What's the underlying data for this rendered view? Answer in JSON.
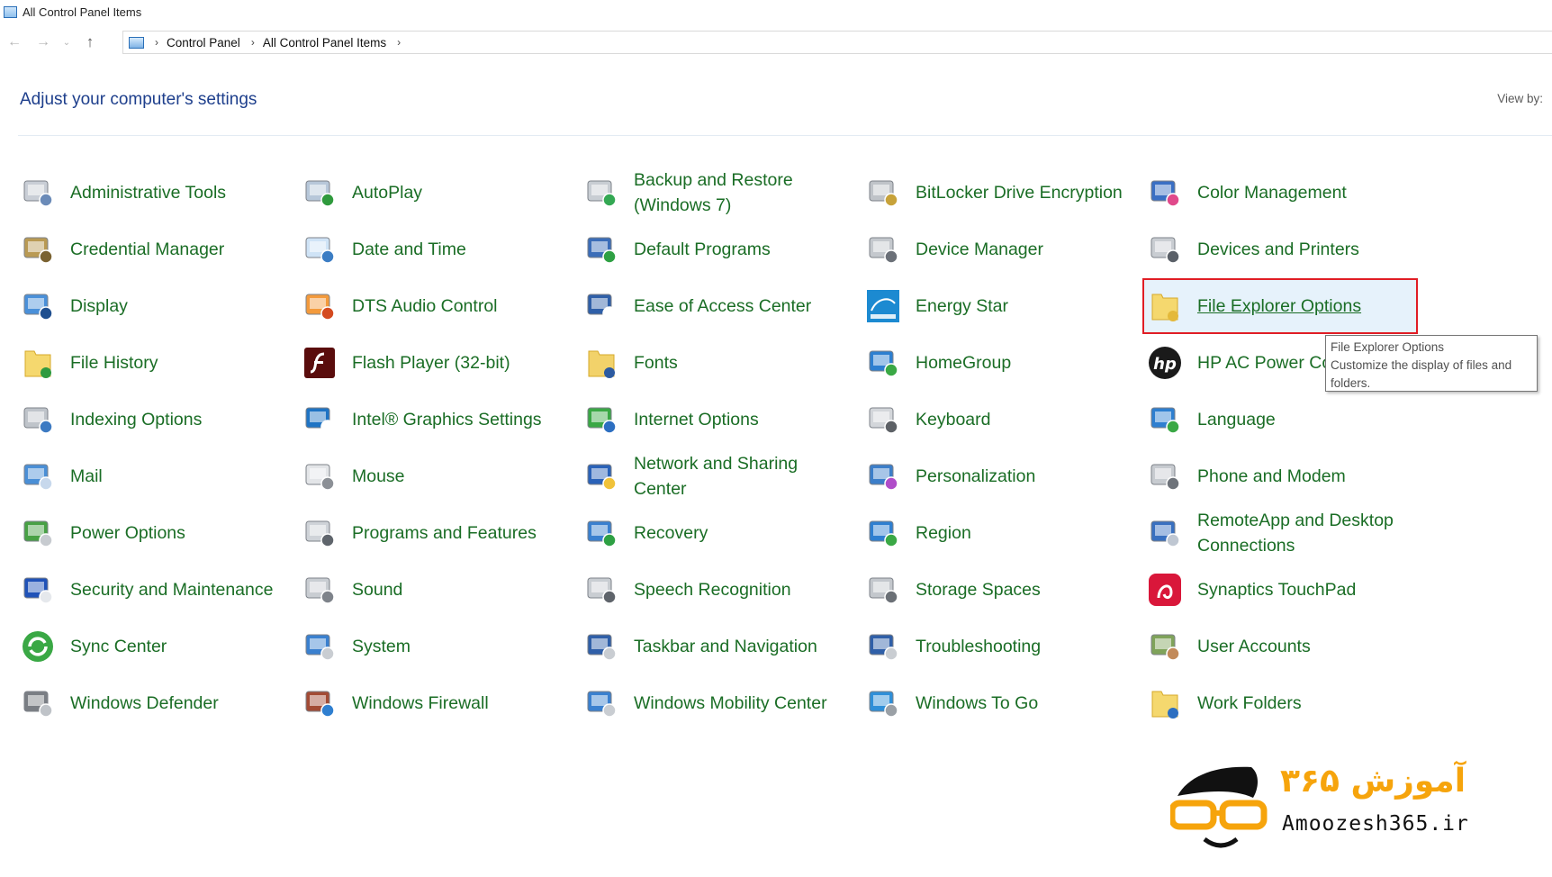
{
  "window": {
    "title": "All Control Panel Items"
  },
  "address": {
    "crumbs": [
      "Control Panel",
      "All Control Panel Items"
    ]
  },
  "header": {
    "title": "Adjust your computer's settings",
    "view_by_label": "View by:"
  },
  "items": [
    {
      "label": "Administrative Tools",
      "icon": "admin-tools-icon"
    },
    {
      "label": "AutoPlay",
      "icon": "autoplay-icon"
    },
    {
      "label": "Backup and Restore (Windows 7)",
      "icon": "backup-icon"
    },
    {
      "label": "BitLocker Drive Encryption",
      "icon": "bitlocker-icon"
    },
    {
      "label": "Color Management",
      "icon": "color-management-icon"
    },
    {
      "label": "Credential Manager",
      "icon": "credential-icon"
    },
    {
      "label": "Date and Time",
      "icon": "clock-icon"
    },
    {
      "label": "Default Programs",
      "icon": "default-programs-icon"
    },
    {
      "label": "Device Manager",
      "icon": "device-manager-icon"
    },
    {
      "label": "Devices and Printers",
      "icon": "printer-icon"
    },
    {
      "label": "Display",
      "icon": "display-icon"
    },
    {
      "label": "DTS Audio Control",
      "icon": "dts-audio-icon"
    },
    {
      "label": "Ease of Access Center",
      "icon": "ease-of-access-icon"
    },
    {
      "label": "Energy Star",
      "icon": "energy-star-icon"
    },
    {
      "label": "File Explorer Options",
      "icon": "folder-options-icon"
    },
    {
      "label": "File History",
      "icon": "file-history-icon"
    },
    {
      "label": "Flash Player (32-bit)",
      "icon": "flash-icon"
    },
    {
      "label": "Fonts",
      "icon": "fonts-icon"
    },
    {
      "label": "HomeGroup",
      "icon": "homegroup-icon"
    },
    {
      "label": "HP AC Power Control",
      "icon": "hp-icon"
    },
    {
      "label": "Indexing Options",
      "icon": "indexing-icon"
    },
    {
      "label": "Intel® Graphics Settings",
      "icon": "intel-graphics-icon"
    },
    {
      "label": "Internet Options",
      "icon": "internet-icon"
    },
    {
      "label": "Keyboard",
      "icon": "keyboard-icon"
    },
    {
      "label": "Language",
      "icon": "language-icon"
    },
    {
      "label": "Mail",
      "icon": "mail-icon"
    },
    {
      "label": "Mouse",
      "icon": "mouse-icon"
    },
    {
      "label": "Network and Sharing Center",
      "icon": "network-icon"
    },
    {
      "label": "Personalization",
      "icon": "personalization-icon"
    },
    {
      "label": "Phone and Modem",
      "icon": "phone-icon"
    },
    {
      "label": "Power Options",
      "icon": "power-icon"
    },
    {
      "label": "Programs and Features",
      "icon": "programs-icon"
    },
    {
      "label": "Recovery",
      "icon": "recovery-icon"
    },
    {
      "label": "Region",
      "icon": "region-icon"
    },
    {
      "label": "RemoteApp and Desktop Connections",
      "icon": "remoteapp-icon"
    },
    {
      "label": "Security and Maintenance",
      "icon": "flag-icon"
    },
    {
      "label": "Sound",
      "icon": "speaker-icon"
    },
    {
      "label": "Speech Recognition",
      "icon": "microphone-icon"
    },
    {
      "label": "Storage Spaces",
      "icon": "storage-icon"
    },
    {
      "label": "Synaptics TouchPad",
      "icon": "touchpad-icon"
    },
    {
      "label": "Sync Center",
      "icon": "sync-icon"
    },
    {
      "label": "System",
      "icon": "system-icon"
    },
    {
      "label": "Taskbar and Navigation",
      "icon": "taskbar-icon"
    },
    {
      "label": "Troubleshooting",
      "icon": "troubleshooting-icon"
    },
    {
      "label": "User Accounts",
      "icon": "users-icon"
    },
    {
      "label": "Windows Defender",
      "icon": "defender-icon"
    },
    {
      "label": "Windows Firewall",
      "icon": "firewall-icon"
    },
    {
      "label": "Windows Mobility Center",
      "icon": "mobility-icon"
    },
    {
      "label": "Windows To Go",
      "icon": "windows-to-go-icon"
    },
    {
      "label": "Work Folders",
      "icon": "work-folders-icon"
    }
  ],
  "tooltip": {
    "title": "File Explorer Options",
    "body": "Customize the display of files and folders."
  },
  "watermark": {
    "latin": "Amoozesh365.ir",
    "persian": "آموزش ۳۶۵"
  },
  "colors": {
    "link_green": "#1a6d25",
    "heading_blue": "#1e3f8c",
    "highlight_bg": "#e6f2fb",
    "highlight_border": "#e01d25",
    "logo_orange": "#f6a40c"
  }
}
